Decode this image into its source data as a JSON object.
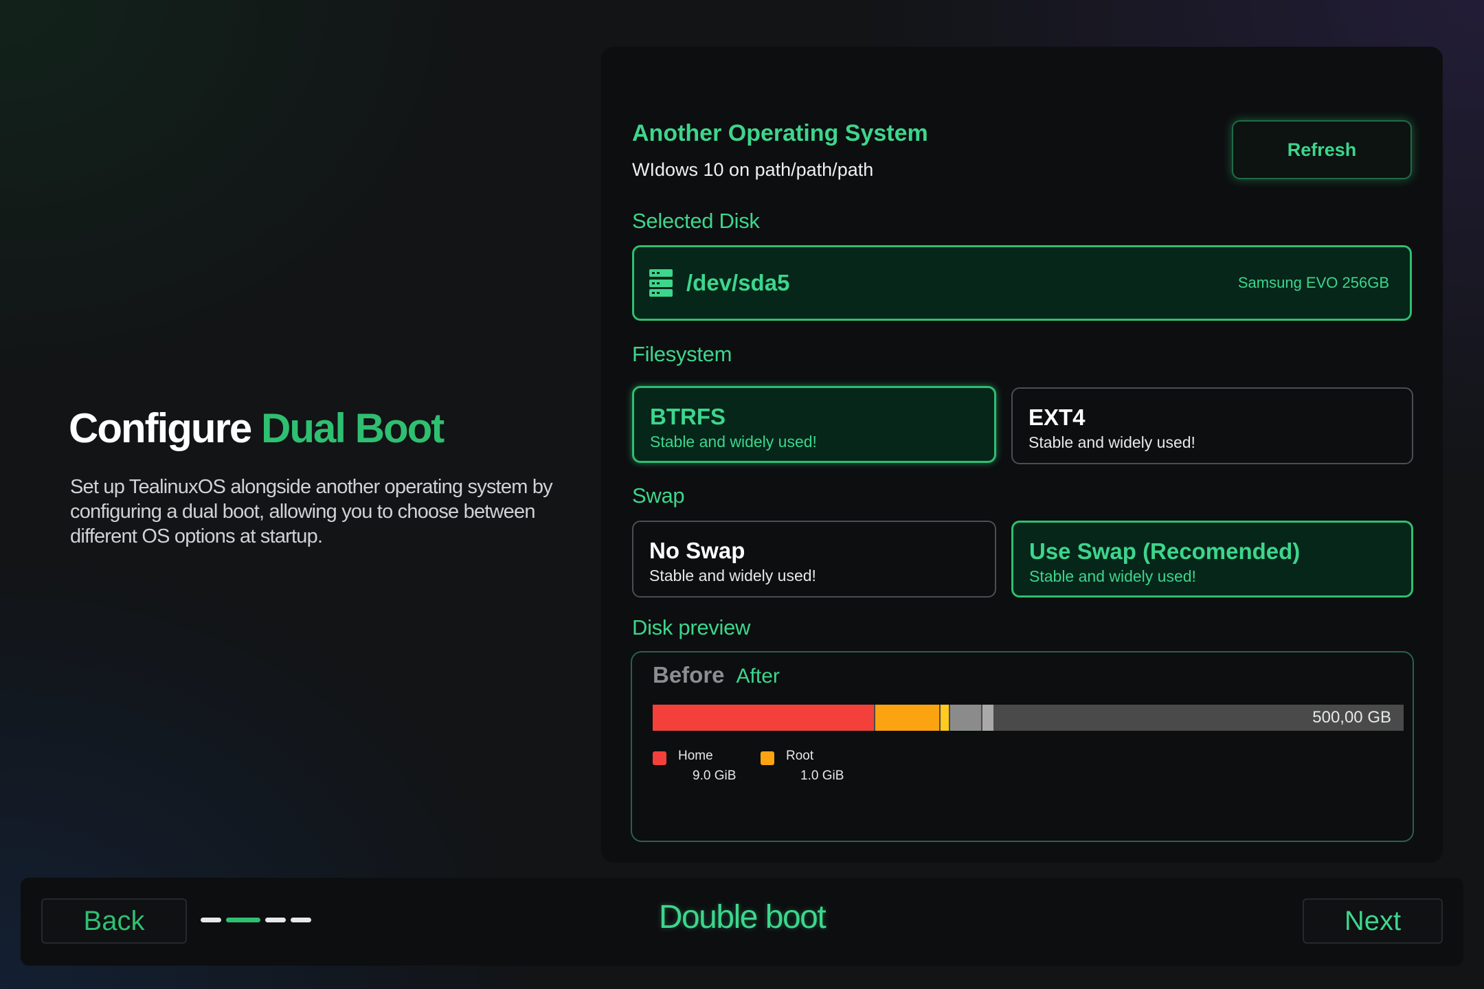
{
  "intro": {
    "title_part1": "Configure",
    "title_part2": "Dual Boot",
    "description": "Set up TealinuxOS alongside another operating system by configuring a dual boot, allowing you to choose between different OS options at startup."
  },
  "os_detect": {
    "title": "Another Operating System",
    "subtitle": "WIdows 10 on path/path/path",
    "refresh_label": "Refresh"
  },
  "disk": {
    "label": "Selected Disk",
    "path": "/dev/sda5",
    "model": "Samsung EVO 256GB",
    "icon": "server-icon"
  },
  "filesystem": {
    "label": "Filesystem",
    "options": [
      {
        "title": "BTRFS",
        "subtitle": "Stable and widely used!",
        "selected": true
      },
      {
        "title": "EXT4",
        "subtitle": "Stable and widely used!",
        "selected": false
      }
    ]
  },
  "swap": {
    "label": "Swap",
    "options": [
      {
        "title": "No Swap",
        "subtitle": "Stable and widely used!",
        "selected": false
      },
      {
        "title": "Use Swap (Recomended)",
        "subtitle": "Stable and widely used!",
        "selected": true
      }
    ]
  },
  "preview": {
    "label": "Disk preview",
    "tabs": [
      "Before",
      "After"
    ],
    "active_tab": "After",
    "total_size": "500,00 GB",
    "legend": [
      {
        "name": "Home",
        "size": "9.0 GiB",
        "color": "#f4403a"
      },
      {
        "name": "Root",
        "size": "1.0 GiB",
        "color": "#fca311"
      }
    ]
  },
  "footer": {
    "back_label": "Back",
    "title": "Double boot",
    "next_label": "Next",
    "steps_total": 4,
    "active_step": 2
  },
  "colors": {
    "accent": "#2fbf71",
    "accent_light": "#3dd68c",
    "selected_bg": "#06261a",
    "card_bg": "#0d0e10"
  }
}
